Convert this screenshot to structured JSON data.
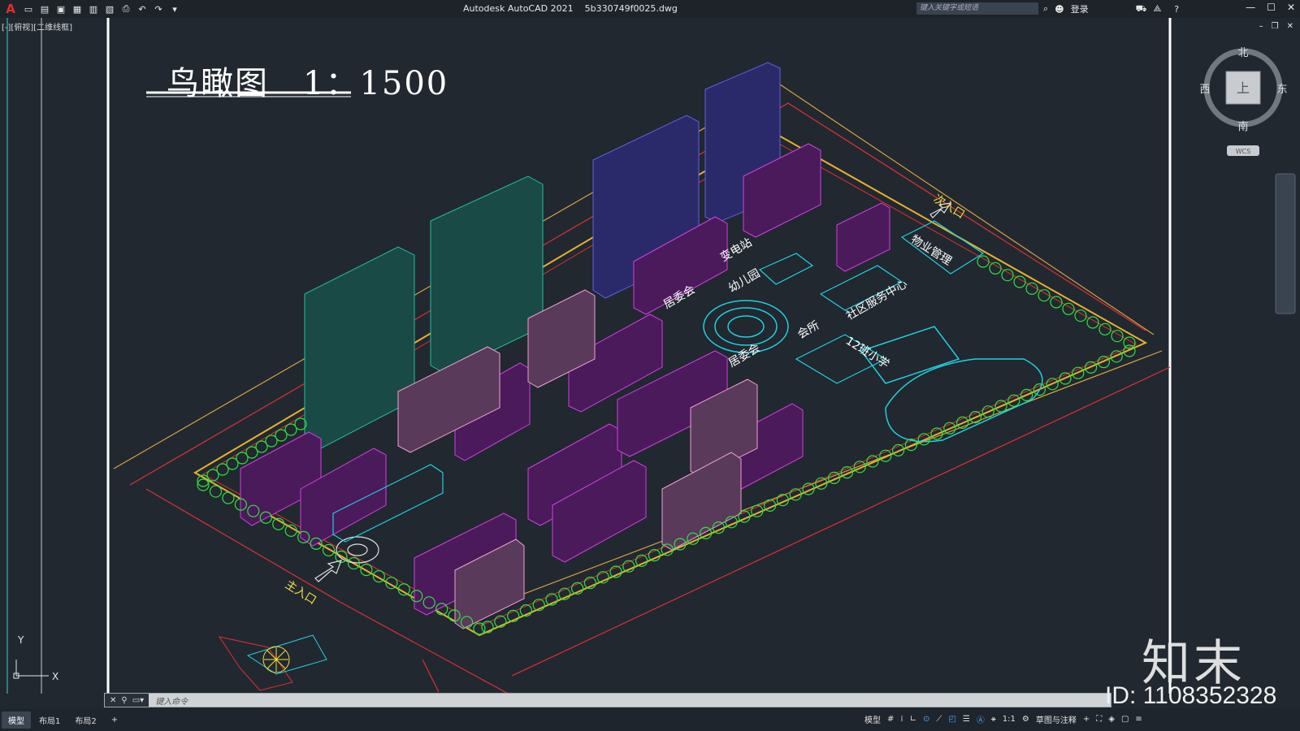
{
  "window": {
    "app_title": "Autodesk AutoCAD 2021",
    "file_name": "5b330749f0025.dwg",
    "search_placeholder": "键入关键字或短语",
    "login_label": "登录"
  },
  "viewport": {
    "view_label": "[-][俯视][二维线框]"
  },
  "viewcube": {
    "north": "北",
    "south": "南",
    "east": "东",
    "west": "西",
    "top_face": "上",
    "wcs_label": "WCS"
  },
  "drawing": {
    "title": "鸟瞰图　1：1500",
    "labels": {
      "main_entrance": "主入口",
      "secondary_entrance": "次入口",
      "property_mgmt": "物业管理",
      "substation": "变电站",
      "kindergarten": "幼儿园",
      "neighborhood_committee": "居委会",
      "resident_committee": "居委会",
      "community_center": "社区服务中心",
      "primary_school": "12班小学",
      "clubhouse": "会所"
    }
  },
  "command": {
    "placeholder": "键入命令"
  },
  "status": {
    "tabs": [
      "模型",
      "布局1",
      "布局2",
      "+"
    ],
    "model_label": "模型",
    "scale": "1:1",
    "workspace": "草图与注释"
  },
  "watermark": {
    "logo_text": "知末",
    "id_text": "ID: 1108352328"
  },
  "colors": {
    "background": "#212830",
    "accent_red": "#e0302a",
    "building_magenta": "#d040e0",
    "building_cyan": "#20c0a0",
    "building_violet": "#6060e0",
    "building_pink": "#f0a0d0",
    "tree_green": "#30e040"
  }
}
